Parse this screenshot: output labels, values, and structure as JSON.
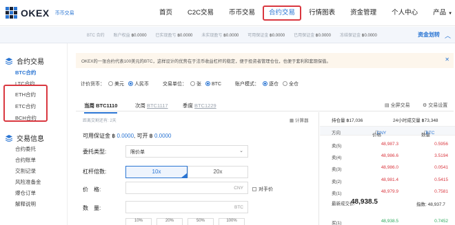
{
  "header": {
    "brand": "OKEX",
    "brand_sub": "币币交易",
    "nav": [
      {
        "label": "首页"
      },
      {
        "label": "C2C交易"
      },
      {
        "label": "币币交易"
      },
      {
        "label": "合约交易"
      },
      {
        "label": "行情图表"
      },
      {
        "label": "资金管理"
      },
      {
        "label": "个人中心"
      },
      {
        "label": "产品"
      }
    ],
    "active_nav": "合约交易"
  },
  "account_bar": {
    "items": [
      {
        "label": "BTC 合约",
        "value": ""
      },
      {
        "label": "账户权益",
        "value": "฿0.0000"
      },
      {
        "label": "已实现盈亏",
        "value": "฿0.0000"
      },
      {
        "label": "未实现盈亏",
        "value": "฿0.0000"
      },
      {
        "label": "可用保证金",
        "value": "฿0.0000"
      },
      {
        "label": "已用保证金",
        "value": "฿0.0000"
      },
      {
        "label": "冻结保证金",
        "value": "฿0.0000"
      }
    ],
    "transfer_link": "资金划转",
    "collapse": "︿"
  },
  "sidebar": {
    "sections": [
      {
        "title": "合约交易",
        "items": [
          "BTC合约",
          "LTC合约",
          "ETH合约",
          "ETC合约",
          "BCH合约"
        ]
      },
      {
        "title": "交易信息",
        "items": [
          "合约委托",
          "合约账单",
          "交割记录",
          "风险准备金",
          "爆仓订单",
          "解释说明"
        ]
      }
    ],
    "active_item": "BTC合约"
  },
  "notice": {
    "text": "OKEX的一张合约代表100美元的BTC，这样设计的优势在于法币收益杠杆的稳定，便于投资者管理仓位，也便于套利和套期保值。",
    "close": "✕"
  },
  "options": {
    "currency_label": "计价货币：",
    "currency": [
      "美元",
      "人民币"
    ],
    "unit_label": "交易单位：",
    "unit": [
      "张",
      "BTC"
    ],
    "mode_label": "账户模式：",
    "mode": [
      "逐仓",
      "全仓"
    ]
  },
  "tabs": {
    "items": [
      {
        "label": "当周",
        "sub": "BTC1110"
      },
      {
        "label": "次周",
        "sub": "BTC1117"
      },
      {
        "label": "季度",
        "sub": "BTC1229"
      }
    ],
    "fullscreen": "全屏交易",
    "settings": "交易设置"
  },
  "form": {
    "deadline": "距离交割还有: 2天",
    "calculator": "计算器",
    "avail_prefix": "可用保证金 ฿ ",
    "avail_margin": "0.0000",
    "avail_mid": ", 可开 ฿ ",
    "avail_open": "0.0000",
    "order_type_label": "委托类型:",
    "order_type": "限价单",
    "leverage_label": "杠杆倍数:",
    "leverage": [
      "10x",
      "20x"
    ],
    "price_label": "价　格:",
    "price_unit": "CNY",
    "peer_price": "对手价",
    "qty_label": "数　量:",
    "qty_unit": "BTC",
    "percents": [
      "10%",
      "20%",
      "50%",
      "100%"
    ]
  },
  "book": {
    "position_label": "持仓量 ฿17,036",
    "volume_label": "24小时成交量 ฿73,348",
    "col_dir": "方向",
    "col_price": "价格",
    "col_price_unit": "CNY",
    "col_qty": "数量",
    "col_qty_unit": "BTC",
    "asks": [
      {
        "label": "卖(5)",
        "price": "48,987.3",
        "qty": "0.5956"
      },
      {
        "label": "卖(4)",
        "price": "48,986.6",
        "qty": "3.5194"
      },
      {
        "label": "卖(3)",
        "price": "48,986.0",
        "qty": "0.0541"
      },
      {
        "label": "卖(2)",
        "price": "48,981.4",
        "qty": "0.5415"
      },
      {
        "label": "卖(1)",
        "price": "48,979.9",
        "qty": "0.7581"
      }
    ],
    "last_label": "最新成交价:",
    "last_price": "48,938.5",
    "index_label": "指数: 48,937.7",
    "bids": [
      {
        "label": "买(1)",
        "price": "48,938.5",
        "qty": "0.7452"
      }
    ]
  },
  "colors": {
    "brand": "#2a75d3",
    "ask": "#d9363e",
    "bid": "#2aa85a",
    "highlight": "#d9363e"
  }
}
